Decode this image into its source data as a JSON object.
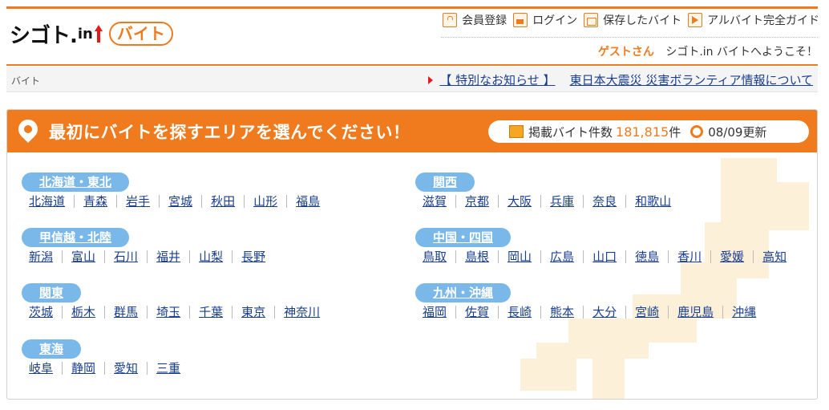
{
  "header": {
    "logo_text": "シゴト.",
    "logo_in": "in",
    "logo_baito": "バイト",
    "nav": [
      {
        "label": "会員登録",
        "icon": "lock-icon"
      },
      {
        "label": "ログイン",
        "icon": "login-icon"
      },
      {
        "label": "保存したバイト",
        "icon": "folder-icon"
      },
      {
        "label": "アルバイト完全ガイド",
        "icon": "guide-icon"
      }
    ],
    "guest": "ゲストさん",
    "welcome": "シゴト.in バイトへようこそ！"
  },
  "breadcrumb": "バイト",
  "notice": {
    "label": "【 特別なお知らせ 】",
    "text": "東日本大震災 災害ボランティア情報について"
  },
  "panel": {
    "title": "最初にバイトを探すエリアを選んでください！",
    "count_label": "掲載バイト件数",
    "count_value": "181,815",
    "count_unit": "件",
    "updated": "08/09更新"
  },
  "regions": [
    {
      "name": "北海道・東北",
      "prefs": [
        "北海道",
        "青森",
        "岩手",
        "宮城",
        "秋田",
        "山形",
        "福島"
      ]
    },
    {
      "name": "甲信越・北陸",
      "prefs": [
        "新潟",
        "富山",
        "石川",
        "福井",
        "山梨",
        "長野"
      ]
    },
    {
      "name": "関東",
      "prefs": [
        "茨城",
        "栃木",
        "群馬",
        "埼玉",
        "千葉",
        "東京",
        "神奈川"
      ]
    },
    {
      "name": "東海",
      "prefs": [
        "岐阜",
        "静岡",
        "愛知",
        "三重"
      ]
    },
    {
      "name": "関西",
      "prefs": [
        "滋賀",
        "京都",
        "大阪",
        "兵庫",
        "奈良",
        "和歌山"
      ]
    },
    {
      "name": "中国・四国",
      "prefs": [
        "鳥取",
        "島根",
        "岡山",
        "広島",
        "山口",
        "徳島",
        "香川",
        "愛媛",
        "高知"
      ]
    },
    {
      "name": "九州・沖縄",
      "prefs": [
        "福岡",
        "佐賀",
        "長崎",
        "熊本",
        "大分",
        "宮崎",
        "鹿児島",
        "沖縄"
      ]
    }
  ],
  "colors": {
    "brand": "#f07a1e",
    "link": "#1a3f8f",
    "region_label": "#7ab8ea"
  }
}
